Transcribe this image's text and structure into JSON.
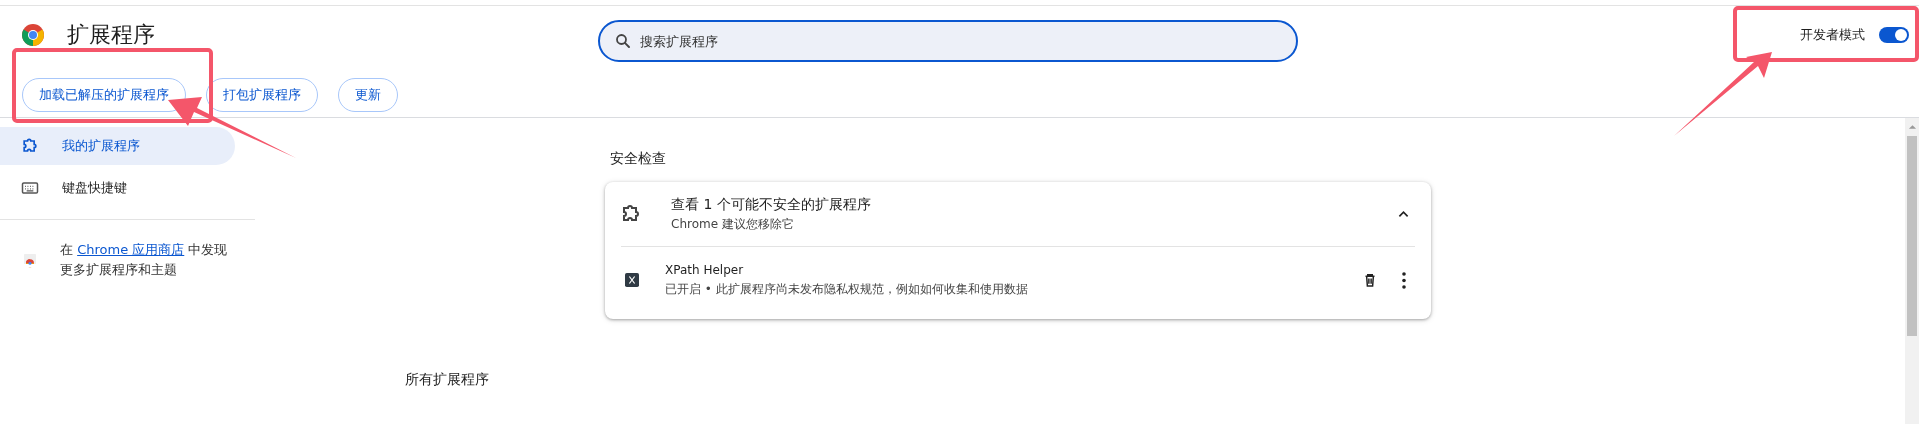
{
  "header": {
    "title": "扩展程序",
    "search": {
      "placeholder": "搜索扩展程序"
    },
    "developer_mode": {
      "label": "开发者模式",
      "on": true
    }
  },
  "toolbar": {
    "buttons": [
      "加载已解压的扩展程序",
      "打包扩展程序",
      "更新"
    ]
  },
  "sidebar": {
    "items": [
      {
        "label": "我的扩展程序",
        "kind": "puzzle",
        "selected": true
      },
      {
        "label": "键盘快捷键",
        "kind": "keyboard",
        "selected": false
      }
    ],
    "store_promo": {
      "before": "在 ",
      "link": "Chrome 应用商店",
      "after": " 中发现更多扩展程序和主题"
    }
  },
  "safety_check": {
    "heading": "安全检查",
    "title": "查看 1 个可能不安全的扩展程序",
    "subtitle": "Chrome 建议您移除它",
    "expanded": true,
    "extensions": [
      {
        "name": "XPath Helper",
        "description": "已开启 • 此扩展程序尚未发布隐私权规范，例如如何收集和使用数据"
      }
    ]
  },
  "all_extensions": {
    "heading": "所有扩展程序"
  }
}
